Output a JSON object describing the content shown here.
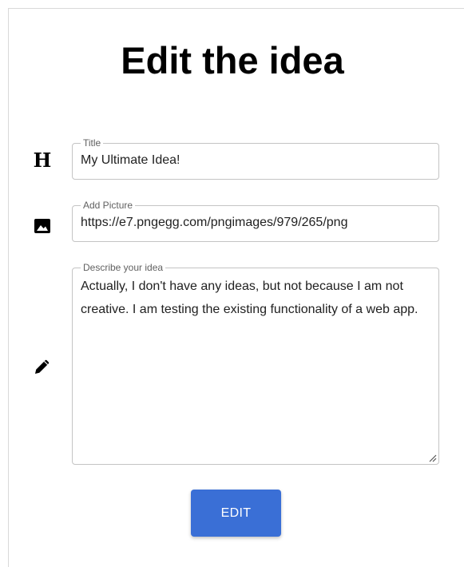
{
  "form": {
    "heading": "Edit the idea",
    "title_field": {
      "label": "Title",
      "value": "My Ultimate Idea!",
      "icon": "heading-icon",
      "icon_glyph": "H"
    },
    "picture_field": {
      "label": "Add Picture",
      "value": "https://e7.pngegg.com/pngimages/979/265/png",
      "icon": "image-icon"
    },
    "description_field": {
      "label": "Describe your idea",
      "value": "Actually, I don't have any ideas, but not because I am not creative. I am testing the existing functionality of a web app.",
      "icon": "pencil-icon"
    },
    "submit_label": "EDIT"
  },
  "colors": {
    "accent": "#3a6fd6",
    "border": "#c4c4c4",
    "label": "#616161"
  }
}
